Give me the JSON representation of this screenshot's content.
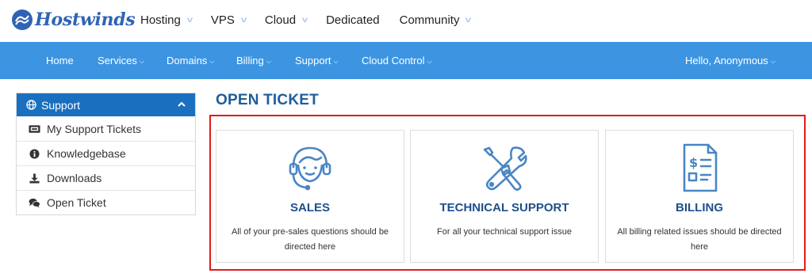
{
  "brand": {
    "name": "Hostwinds"
  },
  "top_nav": [
    {
      "label": "Hosting",
      "has_dropdown": true
    },
    {
      "label": "VPS",
      "has_dropdown": true
    },
    {
      "label": "Cloud",
      "has_dropdown": true
    },
    {
      "label": "Dedicated",
      "has_dropdown": false
    },
    {
      "label": "Community",
      "has_dropdown": true
    }
  ],
  "main_nav": {
    "items": [
      {
        "label": "Home"
      },
      {
        "label": "Services"
      },
      {
        "label": "Domains"
      },
      {
        "label": "Billing"
      },
      {
        "label": "Support"
      },
      {
        "label": "Cloud Control"
      }
    ],
    "user_greeting": "Hello, Anonymous"
  },
  "sidebar": {
    "header": "Support",
    "items": [
      {
        "label": "My Support Tickets",
        "icon": "ticket-icon"
      },
      {
        "label": "Knowledgebase",
        "icon": "info-icon"
      },
      {
        "label": "Downloads",
        "icon": "download-icon"
      },
      {
        "label": "Open Ticket",
        "icon": "comments-icon"
      }
    ]
  },
  "page_title": "OPEN TICKET",
  "departments": [
    {
      "title": "SALES",
      "description": "All of your pre-sales questions should be directed here",
      "icon": "headset-icon"
    },
    {
      "title": "TECHNICAL SUPPORT",
      "description": "For all your technical support issue",
      "icon": "tools-icon"
    },
    {
      "title": "BILLING",
      "description": "All billing related issues should be directed here",
      "icon": "invoice-icon"
    }
  ],
  "colors": {
    "brand_blue": "#2f63b6",
    "nav_blue": "#3d95e2",
    "sidebar_header": "#1a6fbf",
    "icon_blue": "#4a86c5",
    "title_blue": "#1f5d9c",
    "highlight_red": "#e21b1b"
  }
}
